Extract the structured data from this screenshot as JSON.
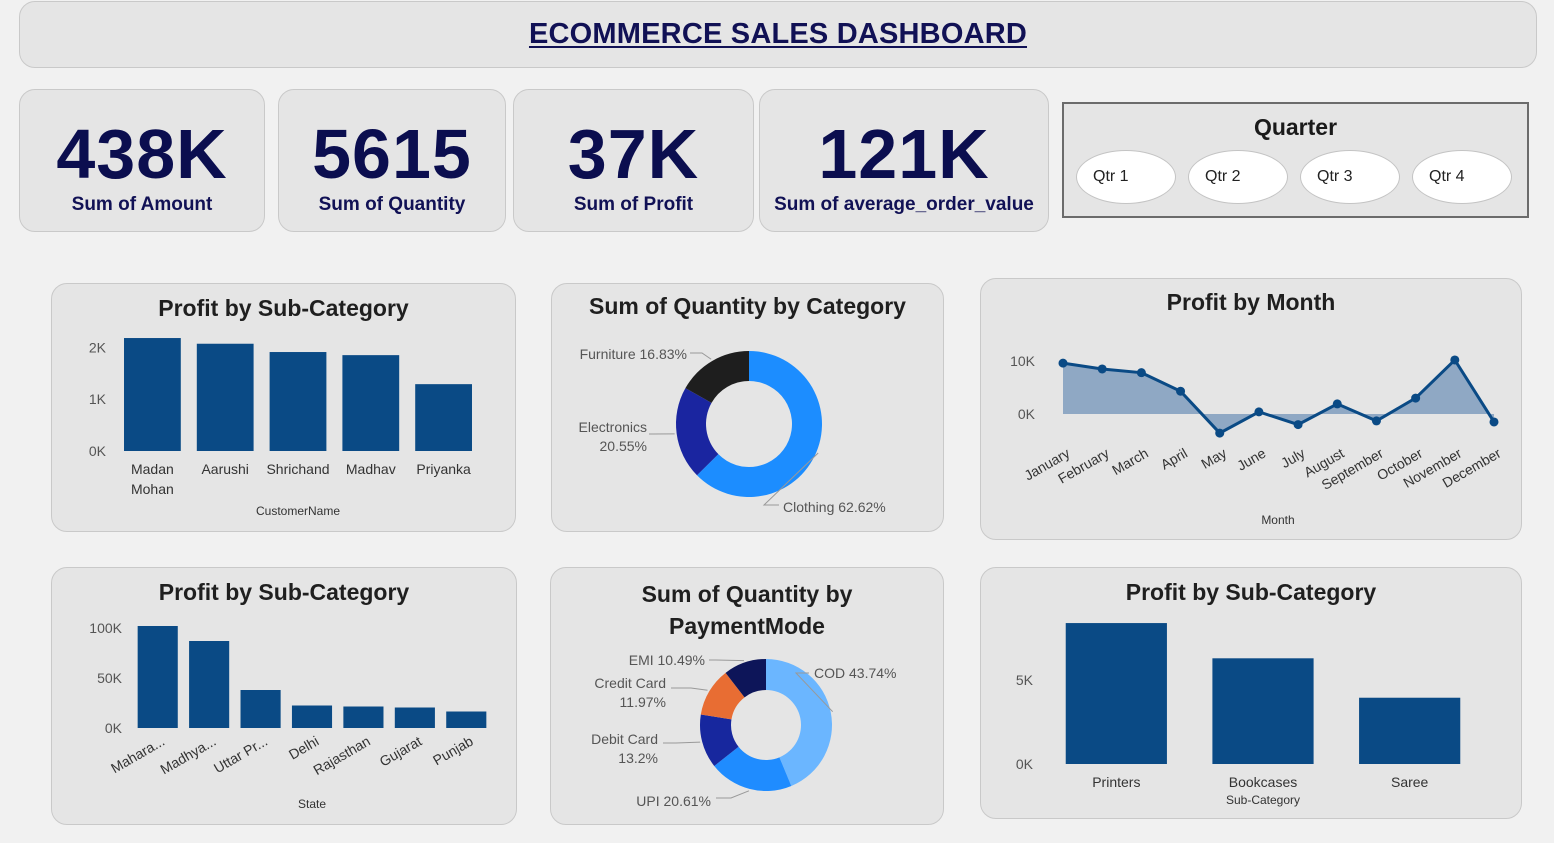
{
  "header": {
    "title": " ECOMMERCE SALES DASHBOARD"
  },
  "kpis": [
    {
      "value": "438K",
      "label": "Sum of Amount"
    },
    {
      "value": "5615",
      "label": "Sum of Quantity"
    },
    {
      "value": "37K",
      "label": "Sum of Profit"
    },
    {
      "value": "121K",
      "label": "Sum of average_order_value"
    }
  ],
  "slicer": {
    "title": "Quarter",
    "options": [
      "Qtr 1",
      "Qtr 2",
      "Qtr 3",
      "Qtr 4"
    ]
  },
  "colors": {
    "bar": "#0a4a85",
    "title": "#111155",
    "donut_cat": [
      "#1c8dff",
      "#1a25a0",
      "#1e1e1e"
    ],
    "donut_pay": [
      "#6bb6ff",
      "#1f8cff",
      "#17279e",
      "#e86d33",
      "#0d1559"
    ]
  },
  "chart_data": [
    {
      "id": "customer-bar",
      "type": "bar",
      "title": "Profit by Sub-Category",
      "xlabel": "CustomerName",
      "ylabel": "",
      "categories": [
        "Madan Mohan",
        "Aarushi",
        "Shrichand",
        "Madhav",
        "Priyanka"
      ],
      "values": [
        2180,
        2070,
        1910,
        1850,
        1290
      ],
      "ylim": [
        0,
        2200
      ],
      "yticks": [
        {
          "v": 0,
          "label": "0K"
        },
        {
          "v": 1000,
          "label": "1K"
        },
        {
          "v": 2000,
          "label": "2K"
        }
      ],
      "grid": false
    },
    {
      "id": "category-donut",
      "type": "pie",
      "title": "Sum of Quantity by Category",
      "slices": [
        {
          "label": "Clothing 62.62%",
          "value": 62.62
        },
        {
          "label": "Electronics 20.55%",
          "value": 20.55
        },
        {
          "label": "Furniture 16.83%",
          "value": 16.83
        }
      ]
    },
    {
      "id": "month-area",
      "type": "area",
      "title": "Profit by Month",
      "xlabel": "Month",
      "ylabel": "",
      "categories": [
        "January",
        "February",
        "March",
        "April",
        "May",
        "June",
        "July",
        "August",
        "September",
        "October",
        "November",
        "December"
      ],
      "values": [
        9600,
        8500,
        7800,
        4300,
        -3600,
        400,
        -2000,
        1900,
        -1300,
        3000,
        10200,
        -1500
      ],
      "ylim": [
        -5000,
        12000
      ],
      "yticks": [
        {
          "v": 0,
          "label": "0K"
        },
        {
          "v": 10000,
          "label": "10K"
        }
      ],
      "grid": false
    },
    {
      "id": "state-bar",
      "type": "bar",
      "title": "Profit by Sub-Category",
      "xlabel": "State",
      "ylabel": "",
      "categories": [
        "Mahara...",
        "Madhya...",
        "Uttar Pr...",
        "Delhi",
        "Rajasthan",
        "Gujarat",
        "Punjab"
      ],
      "values": [
        102000,
        87000,
        38000,
        22500,
        21500,
        20500,
        16500
      ],
      "ylim": [
        0,
        110000
      ],
      "yticks": [
        {
          "v": 0,
          "label": "0K"
        },
        {
          "v": 50000,
          "label": "50K"
        },
        {
          "v": 100000,
          "label": "100K"
        }
      ],
      "grid": false
    },
    {
      "id": "payment-donut",
      "type": "pie",
      "title": "Sum of Quantity by PaymentMode",
      "slices": [
        {
          "label": "COD 43.74%",
          "value": 43.74
        },
        {
          "label": "UPI 20.61%",
          "value": 20.61
        },
        {
          "label": "Debit Card 13.2%",
          "value": 13.2
        },
        {
          "label": "Credit Card 11.97%",
          "value": 11.97
        },
        {
          "label": "EMI 10.49%",
          "value": 10.49
        }
      ]
    },
    {
      "id": "subcat-bar",
      "type": "bar",
      "title": "Profit by Sub-Category",
      "xlabel": "Sub-Category",
      "ylabel": "",
      "categories": [
        "Printers",
        "Bookcases",
        "Saree"
      ],
      "values": [
        8400,
        6300,
        3950
      ],
      "ylim": [
        0,
        9000
      ],
      "yticks": [
        {
          "v": 0,
          "label": "0K"
        },
        {
          "v": 5000,
          "label": "5K"
        }
      ],
      "grid": false
    }
  ]
}
